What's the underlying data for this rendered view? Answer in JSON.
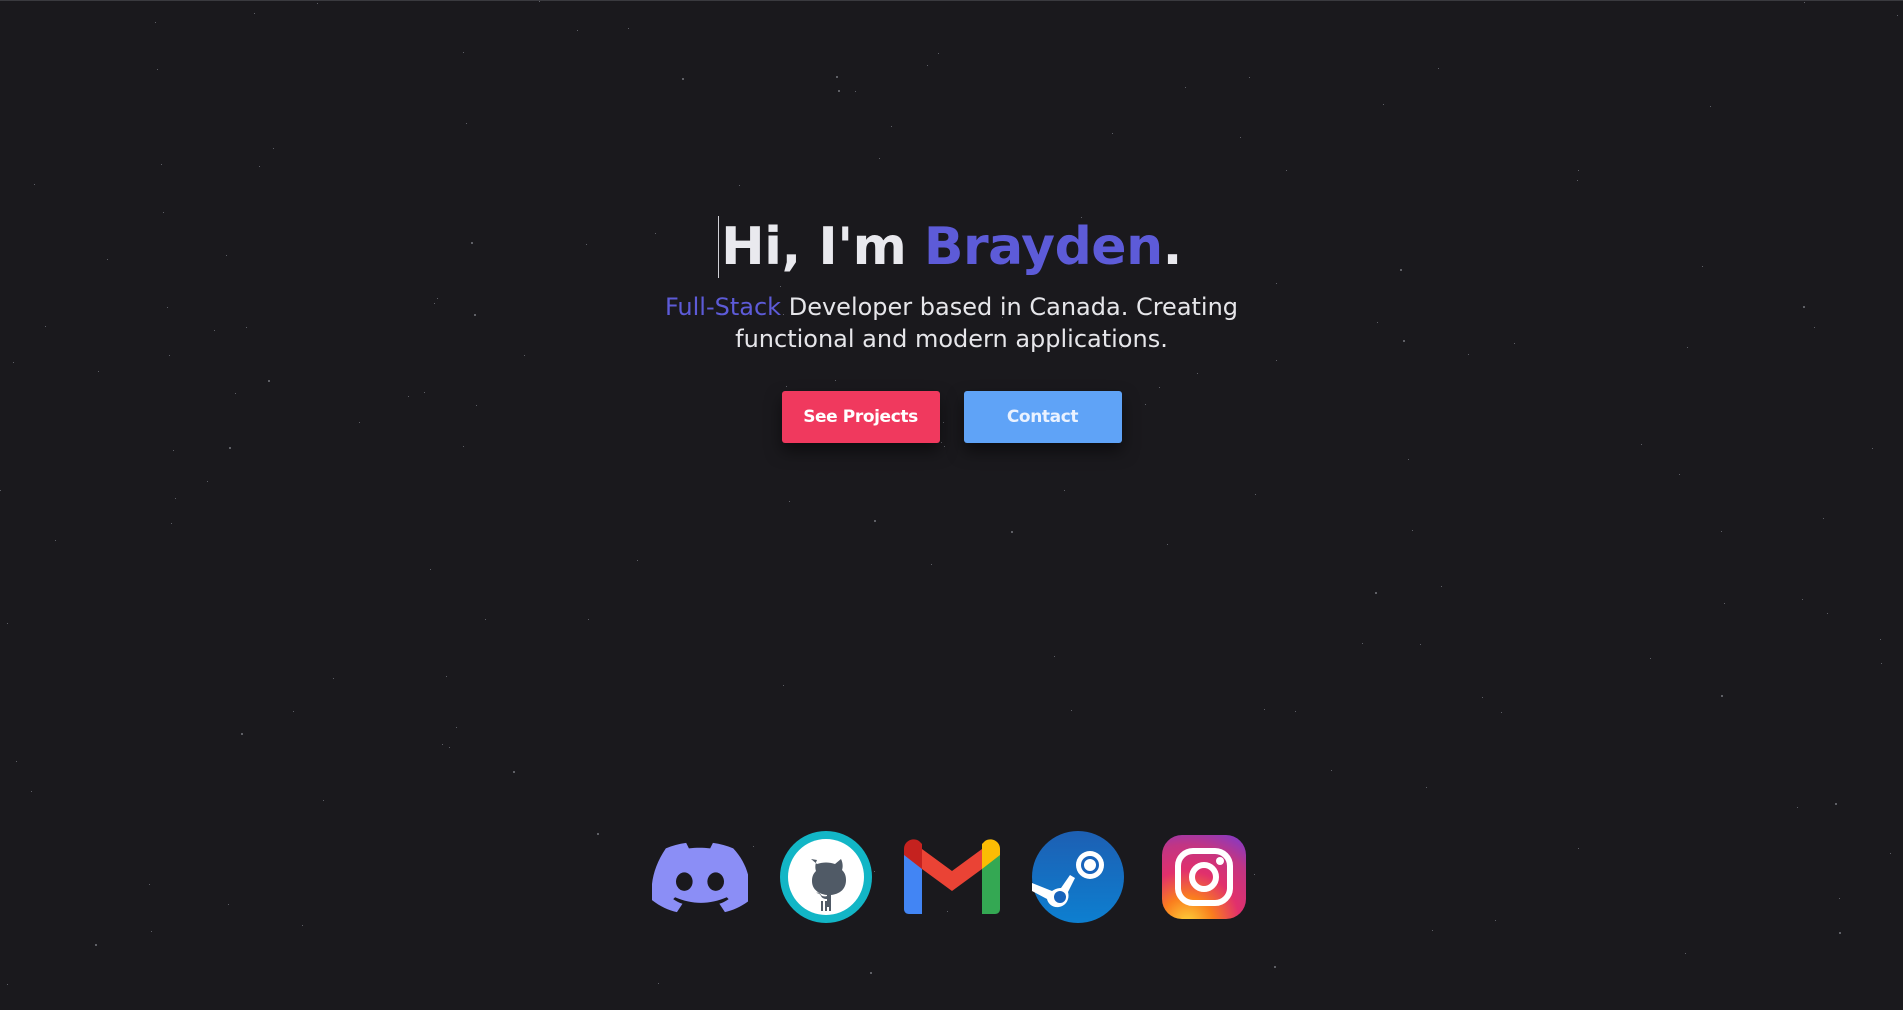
{
  "hero": {
    "greeting": "Hi, I'm ",
    "name": "Brayden",
    "period": ".",
    "tagline_accent": "Full-Stack",
    "tagline_rest": " Developer based in Canada. Creating functional and modern applications."
  },
  "buttons": {
    "projects_label": "See Projects",
    "contact_label": "Contact"
  },
  "socials": [
    {
      "icon": "discord-icon"
    },
    {
      "icon": "github-icon"
    },
    {
      "icon": "gmail-icon"
    },
    {
      "icon": "steam-icon"
    },
    {
      "icon": "instagram-icon"
    }
  ],
  "colors": {
    "background": "#1a191d",
    "accent": "#5d5bd8",
    "projects_button": "#f0395e",
    "contact_button": "#5fa3f7"
  }
}
